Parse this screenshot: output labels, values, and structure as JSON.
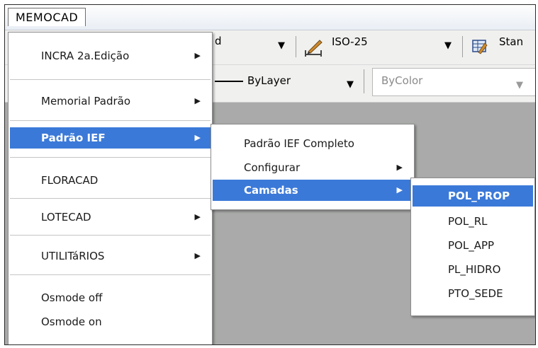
{
  "menubar": {
    "title": "MEMOCAD"
  },
  "toolbar": {
    "dim_style": "ISO-25",
    "text_style_partial": "Stan",
    "linetype": "ByLayer",
    "color": "ByColor",
    "truncated_char": "d"
  },
  "main_menu": {
    "items": [
      {
        "label": "INCRA 2a.Edição"
      },
      {
        "label": "Memorial Padrão"
      },
      {
        "label": "Padrão IEF"
      },
      {
        "label": "FLORACAD"
      },
      {
        "label": "LOTECAD"
      },
      {
        "label": "UTILITáRIOS"
      },
      {
        "label": "Osmode off"
      },
      {
        "label": "Osmode on"
      }
    ]
  },
  "submenu_ief": {
    "items": [
      {
        "label": "Padrão IEF Completo"
      },
      {
        "label": "Configurar"
      },
      {
        "label": "Camadas"
      }
    ]
  },
  "submenu_camadas": {
    "items": [
      {
        "label": "POL_PROP"
      },
      {
        "label": "POL_RL"
      },
      {
        "label": "POL_APP"
      },
      {
        "label": "PL_HIDRO"
      },
      {
        "label": "PTO_SEDE"
      }
    ]
  },
  "colors": {
    "highlight": "#3b79d8",
    "workspace": "#a9aaa9"
  }
}
